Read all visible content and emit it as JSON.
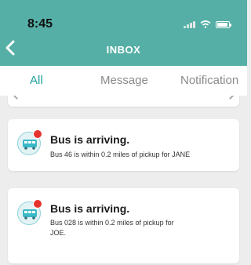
{
  "status_bar": {
    "time": "8:45"
  },
  "header": {
    "title": "INBOX",
    "back_icon": "chevron-left-icon"
  },
  "tabs": [
    {
      "label": "All",
      "active": true
    },
    {
      "label": "Message",
      "active": false
    },
    {
      "label": "Notification",
      "active": false
    }
  ],
  "notifications": [
    {
      "icon": "bus-icon",
      "unread": true,
      "title": "Bus is arriving.",
      "body": "Bus 46 is within 0.2 miles of pickup for  JANE"
    },
    {
      "icon": "bus-icon",
      "unread": true,
      "title": "Bus is arriving.",
      "body": "Bus 028 is within 0.2 miles of pickup for JOE."
    }
  ],
  "colors": {
    "header": "#56afa6",
    "active_tab": "#1f9f99",
    "unread_dot": "#e5322d"
  }
}
